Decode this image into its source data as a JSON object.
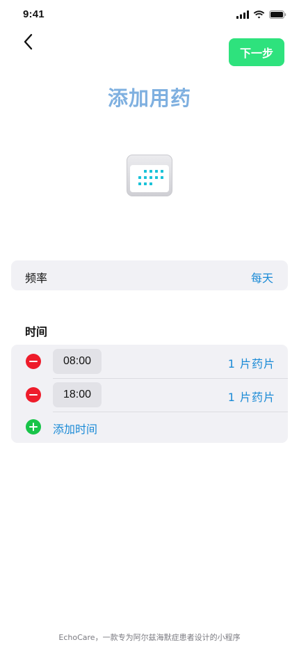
{
  "status_bar": {
    "time": "9:41"
  },
  "nav": {
    "back_icon": "chevron-left-icon",
    "next_label": "下一步"
  },
  "page": {
    "title": "添加用药",
    "illustration_icon": "calendar-icon"
  },
  "frequency": {
    "label": "频率",
    "value": "每天"
  },
  "times_section": {
    "heading": "时间",
    "items": [
      {
        "time": "08:00",
        "dose": "1 片药片"
      },
      {
        "time": "18:00",
        "dose": "1 片药片"
      }
    ],
    "add_label": "添加时间"
  },
  "footer": {
    "text": "EchoCare，一款专为阿尔兹海默症患者设计的小程序"
  },
  "colors": {
    "accent_green": "#2ee27d",
    "title_blue": "#7fb0e0",
    "link_blue": "#1a8ad6",
    "remove_red": "#ee1c2b",
    "add_green": "#18c449",
    "card_background": "#f1f1f5"
  }
}
